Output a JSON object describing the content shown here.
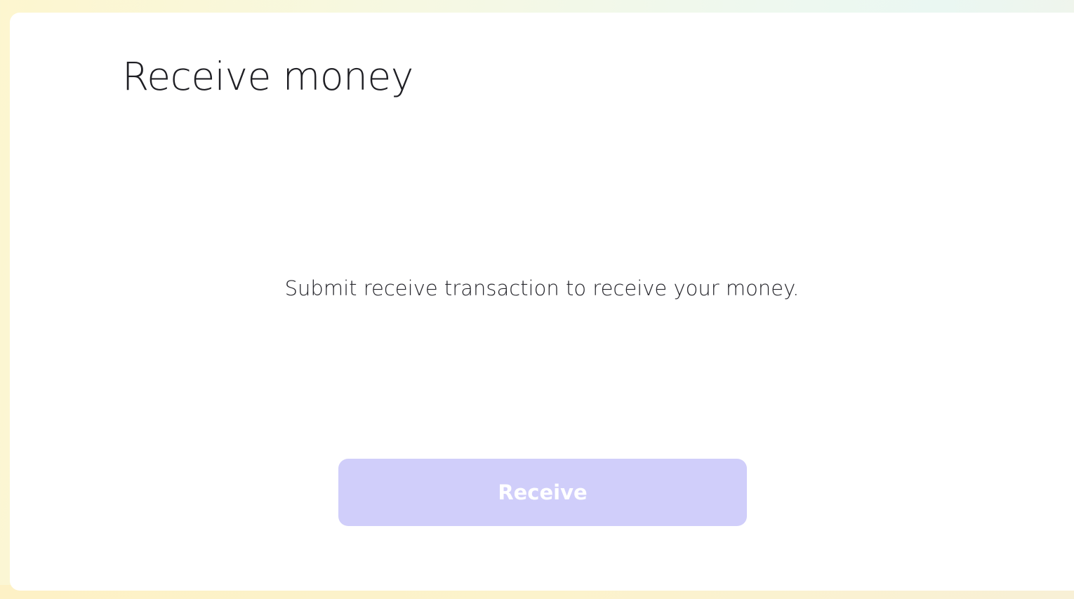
{
  "page": {
    "title": "Receive money",
    "description": "Submit receive transaction to receive your money."
  },
  "actions": {
    "receive_label": "Receive",
    "receive_enabled": false
  },
  "colors": {
    "button_bg": "#d0cefa",
    "button_text": "#ffffff",
    "text": "#1f1f24",
    "card_bg": "#ffffff"
  }
}
